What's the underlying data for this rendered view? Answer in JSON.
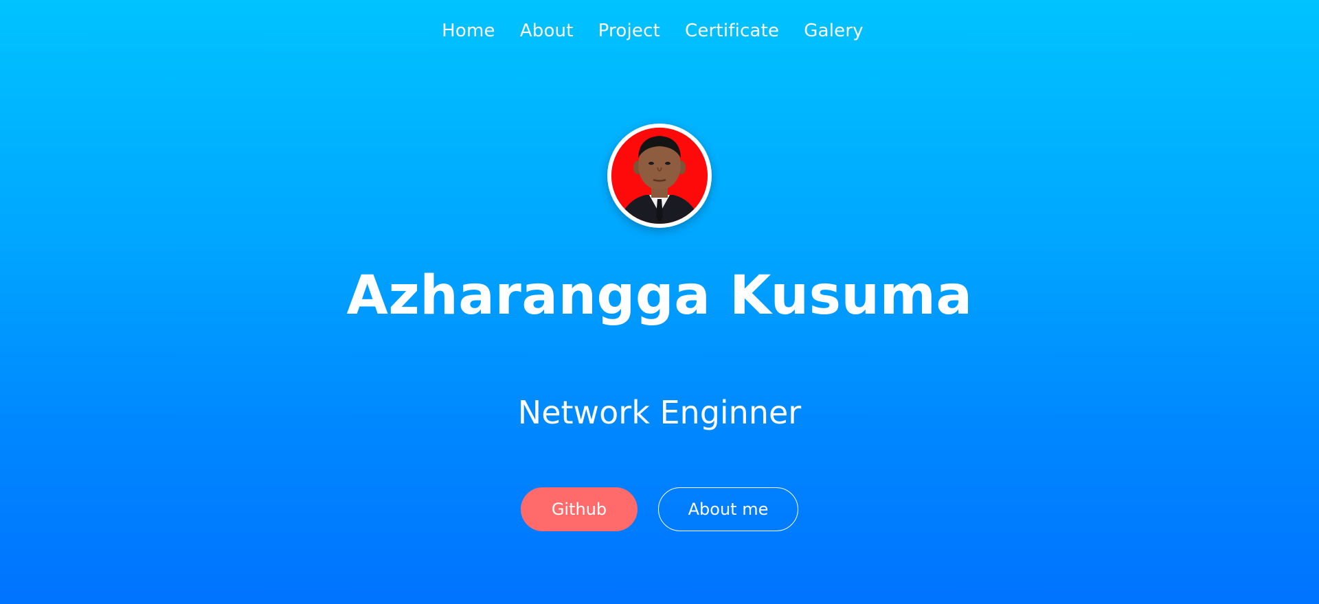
{
  "nav": {
    "items": [
      {
        "label": "Home"
      },
      {
        "label": "About"
      },
      {
        "label": "Project"
      },
      {
        "label": "Certificate"
      },
      {
        "label": "Galery"
      }
    ]
  },
  "hero": {
    "avatar_icon": "profile-photo",
    "name": "Azharangga Kusuma",
    "role": "Network Enginner",
    "buttons": {
      "primary_label": "Github",
      "secondary_label": "About me"
    }
  },
  "colors": {
    "background_top": "#00c3ff",
    "background_bottom": "#0073ff",
    "primary_button": "#ff6b6b",
    "text": "#ffffff",
    "avatar_bg": "#ff0a0a"
  }
}
